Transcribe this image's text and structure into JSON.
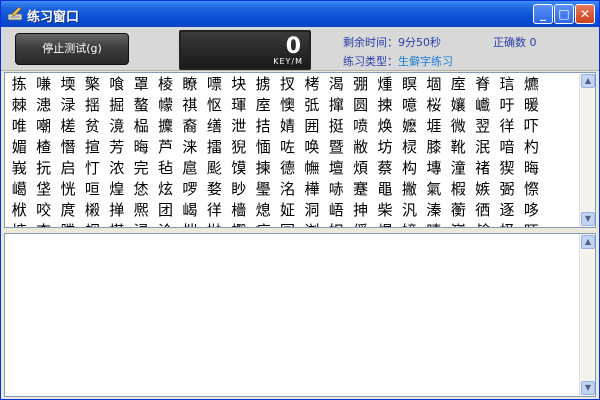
{
  "window": {
    "title": "练习窗口",
    "icon": "keyboard-pencil-icon",
    "min_glyph": "_",
    "max_glyph": "□",
    "close_glyph": "✕"
  },
  "toolbar": {
    "stop_label": "停止测试(g)",
    "counter_value": "0",
    "counter_unit": "KEY/M",
    "remaining_label": "剩余时间：9分50秒",
    "correct_label": "正确数 0",
    "type_label": "练习类型：",
    "type_value": "生僻字练习"
  },
  "characters": [
    [
      "拣",
      "嗛",
      "堧",
      "檠",
      "喰",
      "罩",
      "棱",
      "瞭",
      "嘌",
      "块",
      "掳",
      "扠",
      "栲",
      "渴",
      "弸",
      "煄",
      "瞑",
      "堌",
      "庢",
      "脊",
      "琂",
      "爊"
    ],
    [
      "棘",
      "漶",
      "渌",
      "揺",
      "掘",
      "螯",
      "幪",
      "祺",
      "怄",
      "琿",
      "庢",
      "懊",
      "弤",
      "撺",
      "圆",
      "捒",
      "噫",
      "桜",
      "孃",
      "巇",
      "吁",
      "暖"
    ],
    [
      "唯",
      "嘲",
      "槎",
      "贫",
      "滰",
      "榀",
      "攈",
      "裔",
      "缮",
      "泄",
      "拮",
      "婧",
      "囲",
      "挺",
      "喷",
      "焕",
      "嬷",
      "堐",
      "微",
      "翌",
      "徉",
      "吓"
    ],
    [
      "媚",
      "楂",
      "憯",
      "揎",
      "芳",
      "晦",
      "芦",
      "涞",
      "擂",
      "猊",
      "愐",
      "咗",
      "唤",
      "暨",
      "敝",
      "坊",
      "棂",
      "膝",
      "靴",
      "泯",
      "喑",
      "杓"
    ],
    [
      "峩",
      "抏",
      "启",
      "忊",
      "浓",
      "完",
      "毡",
      "扈",
      "颩",
      "馍",
      "揀",
      "德",
      "幠",
      "壇",
      "煩",
      "蔡",
      "构",
      "塼",
      "潼",
      "禇",
      "猰",
      "晦"
    ],
    [
      "嶱",
      "垡",
      "恍",
      "咺",
      "煌",
      "恷",
      "炫",
      "啰",
      "婺",
      "眇",
      "璺",
      "洺",
      "樺",
      "哧",
      "蹇",
      "黽",
      "撇",
      "氣",
      "椵",
      "嫉",
      "弻",
      "憏"
    ],
    [
      "栿",
      "咬",
      "庹",
      "樧",
      "掸",
      "熈",
      "团",
      "嵑",
      "徉",
      "檣",
      "熄",
      "姃",
      "洞",
      "峿",
      "抻",
      "柴",
      "汎",
      "溱",
      "蘅",
      "徆",
      "逐",
      "哆"
    ],
    [
      "塘",
      "杏",
      "媵",
      "蜩",
      "椹",
      "浸",
      "泠",
      "恺",
      "抛",
      "蠮",
      "痾",
      "囩",
      "浏",
      "妲",
      "僢",
      "煋",
      "嫜",
      "睛",
      "巅",
      "鹼",
      "柽",
      "眄"
    ]
  ]
}
